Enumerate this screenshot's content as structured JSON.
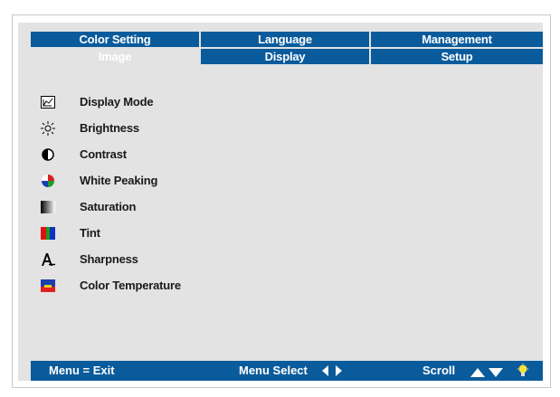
{
  "tabs": {
    "row1": [
      "Color Setting",
      "Language",
      "Management"
    ],
    "row2": [
      "Image",
      "Display",
      "Setup"
    ],
    "active": "Image"
  },
  "menu": [
    {
      "icon": "display-mode-icon",
      "label": "Display Mode"
    },
    {
      "icon": "brightness-icon",
      "label": "Brightness"
    },
    {
      "icon": "contrast-icon",
      "label": "Contrast"
    },
    {
      "icon": "white-peaking-icon",
      "label": "White Peaking"
    },
    {
      "icon": "saturation-icon",
      "label": "Saturation"
    },
    {
      "icon": "tint-icon",
      "label": "Tint"
    },
    {
      "icon": "sharpness-icon",
      "label": "Sharpness"
    },
    {
      "icon": "color-temperature-icon",
      "label": "Color Temperature"
    }
  ],
  "status": {
    "exit": "Menu = Exit",
    "select": "Menu Select",
    "scroll": "Scroll"
  },
  "colors": {
    "accent": "#0a5b9c",
    "panel": "#e3e3e3"
  }
}
